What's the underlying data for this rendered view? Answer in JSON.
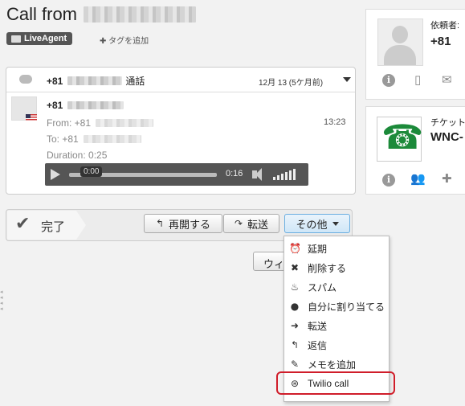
{
  "header": {
    "title": "Call from",
    "tag_label": "LiveAgent",
    "add_tag_label": "✚ タグを追加"
  },
  "call": {
    "number": "+81",
    "header_suffix": "通話",
    "date": "12月 13 (5ケ月前)",
    "from_label": "From: +81",
    "to_label": "To: +81",
    "duration_label": "Duration: 0:25",
    "time": "13:23",
    "player": {
      "current": "0:00",
      "length": "0:16",
      "progress": 0
    }
  },
  "customer": {
    "label": "依頼者:",
    "number": "+81"
  },
  "ticket": {
    "label": "チケット",
    "code": "WNC-"
  },
  "actions": {
    "done_label": "完了",
    "reopen_label": "再開する",
    "forward_label": "転送",
    "other_label": "その他",
    "window_label": "ウィ"
  },
  "menu": {
    "items": [
      {
        "label": "延期",
        "icon": "alarm-clock-icon"
      },
      {
        "label": "削除する",
        "icon": "x-icon"
      },
      {
        "label": "スパム",
        "icon": "flame-icon"
      },
      {
        "label": "自分に割り当てる",
        "icon": "person-icon"
      },
      {
        "label": "転送",
        "icon": "arrow-right-icon"
      },
      {
        "label": "返信",
        "icon": "reply-icon"
      },
      {
        "label": "メモを追加",
        "icon": "note-icon"
      },
      {
        "label": "Twilio call",
        "icon": "twilio-icon"
      }
    ]
  },
  "colors": {
    "highlight": "#d01d2a",
    "accent_button": "#6aaee0",
    "phone_green": "#1c8a3a"
  }
}
